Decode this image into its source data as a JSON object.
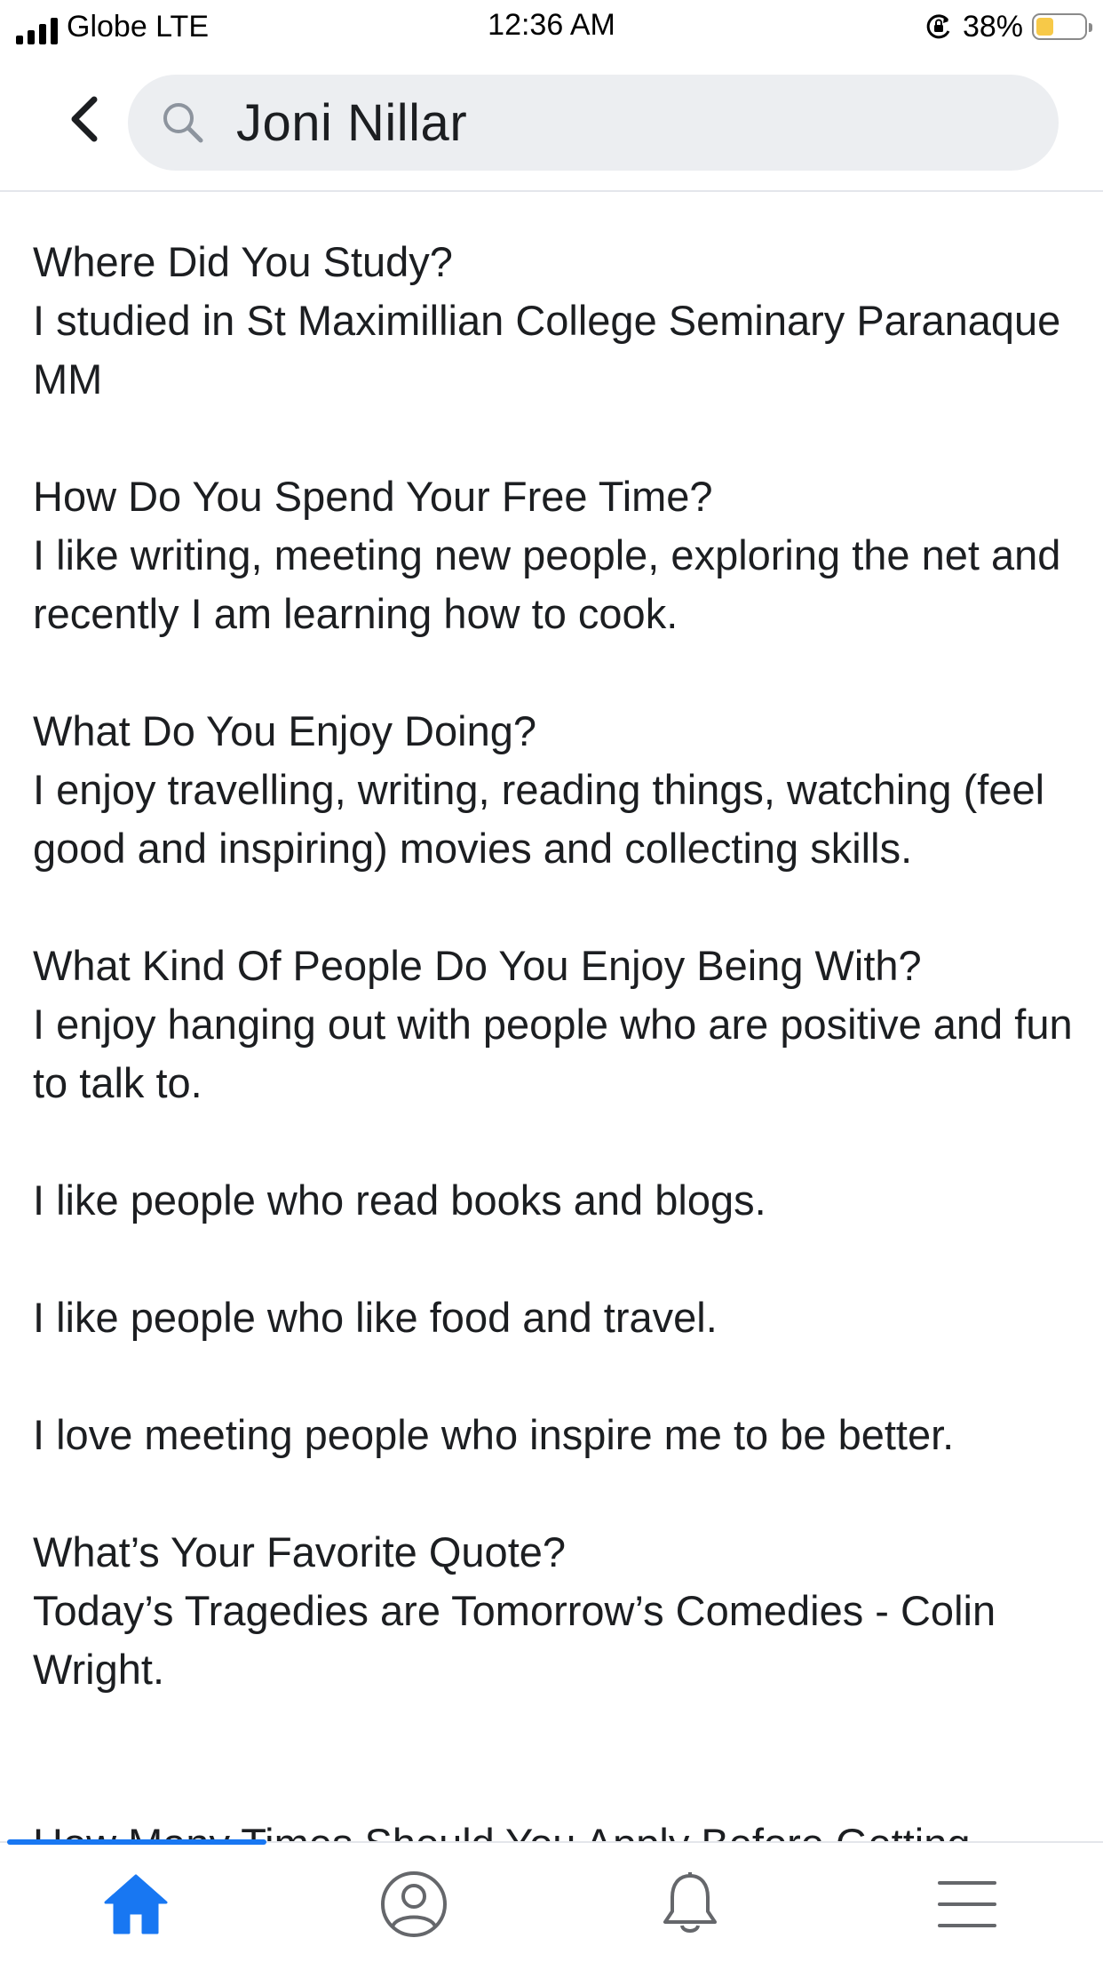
{
  "status_bar": {
    "carrier": "Globe LTE",
    "time": "12:36 AM",
    "battery_percent": "38%",
    "battery_level": 0.38
  },
  "search": {
    "query": "Joni Nillar"
  },
  "sections": [
    {
      "question": "Where Did You Study?",
      "answer": "I studied in St Maximillian College Seminary Paranaque MM"
    },
    {
      "question": "How Do You Spend Your Free Time?",
      "answer": "I like writing, meeting new people, exploring the net and recently I am learning how to cook."
    },
    {
      "question": "What Do You Enjoy Doing?",
      "answer": "I enjoy travelling, writing, reading things, watching (feel good and inspiring) movies and collecting skills."
    },
    {
      "question": "What Kind Of People Do You Enjoy Being With?",
      "answer": "I enjoy hanging out with people who are positive and fun to talk to."
    },
    {
      "question": "",
      "answer": "I like people who read books and blogs."
    },
    {
      "question": "",
      "answer": "I like people who like food and travel."
    },
    {
      "question": "",
      "answer": "I love meeting people who inspire me to be better."
    },
    {
      "question": "What’s Your Favorite Quote?",
      "answer": "Today’s Tragedies are Tomorrow’s Comedies - Colin Wright."
    }
  ],
  "partial_line": "How Many Times Should You Apply Before Getting",
  "tabs": [
    {
      "icon": "home-icon",
      "active": true
    },
    {
      "icon": "profile-icon",
      "active": false
    },
    {
      "icon": "bell-icon",
      "active": false
    },
    {
      "icon": "menu-icon",
      "active": false
    }
  ],
  "colors": {
    "accent": "#1877f2",
    "text": "#1c1e21",
    "search_bg": "#eceef1",
    "battery": "#f7c948"
  }
}
